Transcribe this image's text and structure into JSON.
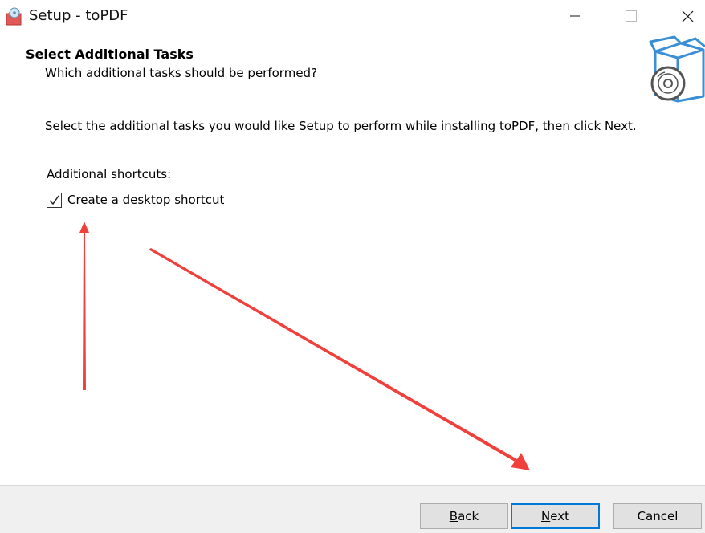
{
  "window": {
    "title": "Setup - toPDF",
    "icon": "installer-disc-icon",
    "controls": [
      "minimize-icon",
      "maximize-icon",
      "close-icon"
    ]
  },
  "header": {
    "title": "Select Additional Tasks",
    "subtitle": "Which additional tasks should be performed?",
    "icon": "box-disc-icon"
  },
  "body": {
    "instruction": "Select the additional tasks you would like Setup to perform while installing toPDF, then click Next.",
    "group_label": "Additional shortcuts:",
    "tasks": [
      {
        "label_before": "Create a ",
        "accel": "d",
        "label_after": "esktop shortcut",
        "checked": true
      }
    ]
  },
  "footer": {
    "buttons": [
      {
        "accel": "B",
        "rest": "ack"
      },
      {
        "accel": "N",
        "rest": "ext"
      },
      {
        "label": "Cancel"
      }
    ]
  },
  "colors": {
    "annotation_arrow": "#f0403c",
    "default_button_border": "#0078d7",
    "icon_blue": "#3a8fd6"
  }
}
